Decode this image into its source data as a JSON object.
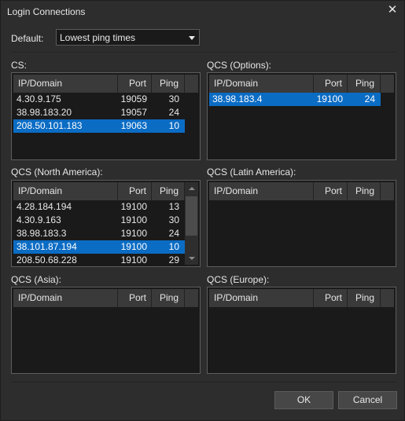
{
  "window": {
    "title": "Login Connections"
  },
  "default": {
    "label": "Default:",
    "selected": "Lowest ping times"
  },
  "columns": {
    "ip": "IP/Domain",
    "port": "Port",
    "ping": "Ping"
  },
  "groups": {
    "cs": {
      "label": "CS:",
      "rows": [
        {
          "ip": "4.30.9.175",
          "port": "19059",
          "ping": "30",
          "selected": false
        },
        {
          "ip": "38.98.183.20",
          "port": "19057",
          "ping": "24",
          "selected": false
        },
        {
          "ip": "208.50.101.183",
          "port": "19063",
          "ping": "10",
          "selected": true
        }
      ]
    },
    "qcs_options": {
      "label": "QCS (Options):",
      "rows": [
        {
          "ip": "38.98.183.4",
          "port": "19100",
          "ping": "24",
          "selected": true
        }
      ]
    },
    "qcs_north_america": {
      "label": "QCS (North America):",
      "rows": [
        {
          "ip": "4.28.184.194",
          "port": "19100",
          "ping": "13",
          "selected": false
        },
        {
          "ip": "4.30.9.163",
          "port": "19100",
          "ping": "30",
          "selected": false
        },
        {
          "ip": "38.98.183.3",
          "port": "19100",
          "ping": "24",
          "selected": false
        },
        {
          "ip": "38.101.87.194",
          "port": "19100",
          "ping": "10",
          "selected": true
        },
        {
          "ip": "208.50.68.228",
          "port": "19100",
          "ping": "29",
          "selected": false
        }
      ]
    },
    "qcs_latin_america": {
      "label": "QCS (Latin America):",
      "rows": []
    },
    "qcs_asia": {
      "label": "QCS (Asia):",
      "rows": []
    },
    "qcs_europe": {
      "label": "QCS (Europe):",
      "rows": []
    }
  },
  "buttons": {
    "ok": "OK",
    "cancel": "Cancel"
  },
  "colors": {
    "selection": "#0b6cc4",
    "background": "#2d2d2d",
    "list_background": "#1a1a1a"
  }
}
